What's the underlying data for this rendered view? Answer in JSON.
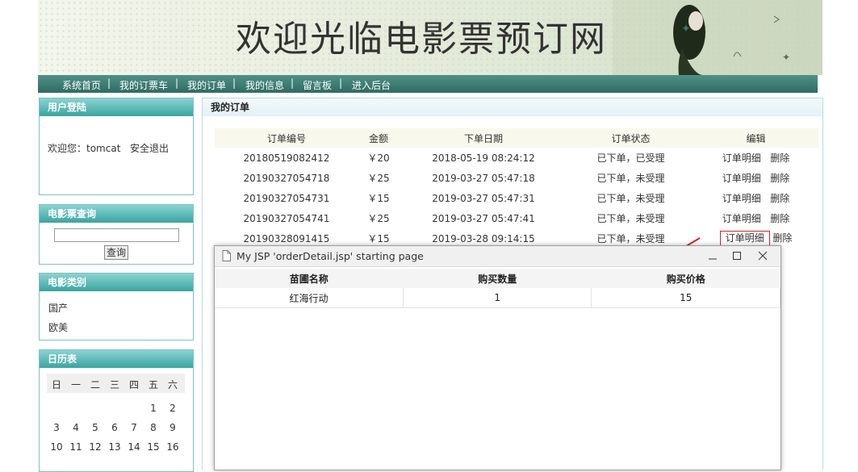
{
  "banner": {
    "title": "欢迎光临电影票预订网"
  },
  "nav": {
    "items": [
      "系统首页",
      "我的订票车",
      "我的订单",
      "我的信息",
      "留言板",
      "进入后台"
    ],
    "sep": "|"
  },
  "login": {
    "header": "用户登陆",
    "welcome": "欢迎您：tomcat",
    "logout": "安全退出"
  },
  "search": {
    "header": "电影票查询",
    "input_value": "",
    "button": "查询"
  },
  "categories": {
    "header": "电影类别",
    "items": [
      "国产",
      "欧美"
    ]
  },
  "calendar": {
    "header": "日历表",
    "weekdays": [
      "日",
      "一",
      "二",
      "三",
      "四",
      "五",
      "六"
    ],
    "rows": [
      [
        "",
        "",
        "",
        "",
        "",
        "1",
        "2"
      ],
      [
        "3",
        "4",
        "5",
        "6",
        "7",
        "8",
        "9"
      ],
      [
        "10",
        "11",
        "12",
        "13",
        "14",
        "15",
        "16"
      ]
    ]
  },
  "orders": {
    "title": "我的订单",
    "columns": [
      "订单编号",
      "金额",
      "下单日期",
      "订单状态",
      "编辑"
    ],
    "detail_link": "订单明细",
    "delete_link": "删除",
    "rows": [
      {
        "id": "20180519082412",
        "amount": "￥20",
        "date": "2018-05-19 08:24:12",
        "status": "已下单，已受理"
      },
      {
        "id": "20190327054718",
        "amount": "￥25",
        "date": "2019-03-27 05:47:18",
        "status": "已下单，未受理"
      },
      {
        "id": "20190327054731",
        "amount": "￥15",
        "date": "2019-03-27 05:47:31",
        "status": "已下单，未受理"
      },
      {
        "id": "20190327054741",
        "amount": "￥25",
        "date": "2019-03-27 05:47:41",
        "status": "已下单，未受理"
      },
      {
        "id": "20190328091415",
        "amount": "￥15",
        "date": "2019-03-28 09:14:15",
        "status": "已下单，未受理"
      }
    ]
  },
  "popup": {
    "title": "My JSP 'orderDetail.jsp' starting page",
    "columns": [
      "苗圃名称",
      "购买数量",
      "购买价格"
    ],
    "rows": [
      {
        "name": "红海行动",
        "qty": "1",
        "price": "15"
      }
    ]
  },
  "colors": {
    "nav": "#2f6c63",
    "sidebox_head": "#3aa5a1",
    "highlight": "#e02020"
  }
}
